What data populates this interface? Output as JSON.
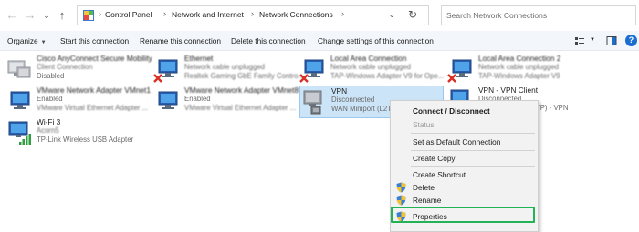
{
  "breadcrumb": {
    "items": [
      "Control Panel",
      "Network and Internet",
      "Network Connections"
    ]
  },
  "search": {
    "placeholder": "Search Network Connections"
  },
  "toolbar": {
    "organize": "Organize",
    "start": "Start this connection",
    "rename": "Rename this connection",
    "delete": "Delete this connection",
    "change": "Change settings of this connection"
  },
  "connections": [
    {
      "name": "Cisco AnyConnect Secure Mobility",
      "line2": "Client Connection",
      "line3": "Disabled"
    },
    {
      "name": "Ethernet",
      "line2": "Network cable unplugged",
      "line3": "Realtek Gaming GbE Family Contro..."
    },
    {
      "name": "Local Area Connection",
      "line2": "Network cable unplugged",
      "line3": "TAP-Windows Adapter V9 for Ope..."
    },
    {
      "name": "Local Area Connection 2",
      "line2": "Network cable unplugged",
      "line3": "TAP-Windows Adapter V9"
    },
    {
      "name": "VMware Network Adapter VMnet1",
      "line2": "Enabled",
      "line3": "VMware Virtual Ethernet Adapter ..."
    },
    {
      "name": "VMware Network Adapter VMnet8",
      "line2": "Enabled",
      "line3": "VMware Virtual Ethernet Adapter ..."
    },
    {
      "name": "VPN",
      "line2": "Disconnected",
      "line3": "WAN Miniport (L2TP)"
    },
    {
      "name": "VPN - VPN Client",
      "line2": "Disconnected",
      "line3": "WAN Miniport (PPTP) - VPN"
    },
    {
      "name": "Wi-Fi 3",
      "line2": "Acorn5",
      "line3": "TP-Link Wireless USB Adapter"
    }
  ],
  "context_menu": {
    "connect": "Connect / Disconnect",
    "status": "Status",
    "default": "Set as Default Connection",
    "copy": "Create Copy",
    "shortcut": "Create Shortcut",
    "delete": "Delete",
    "rename": "Rename",
    "properties": "Properties"
  },
  "colors": {
    "accent": "#1c6dd0",
    "selection": "#cce4f7",
    "highlight_box": "#21b356",
    "error_x": "#d93025",
    "wifi_bars": "#2e9e3e"
  }
}
